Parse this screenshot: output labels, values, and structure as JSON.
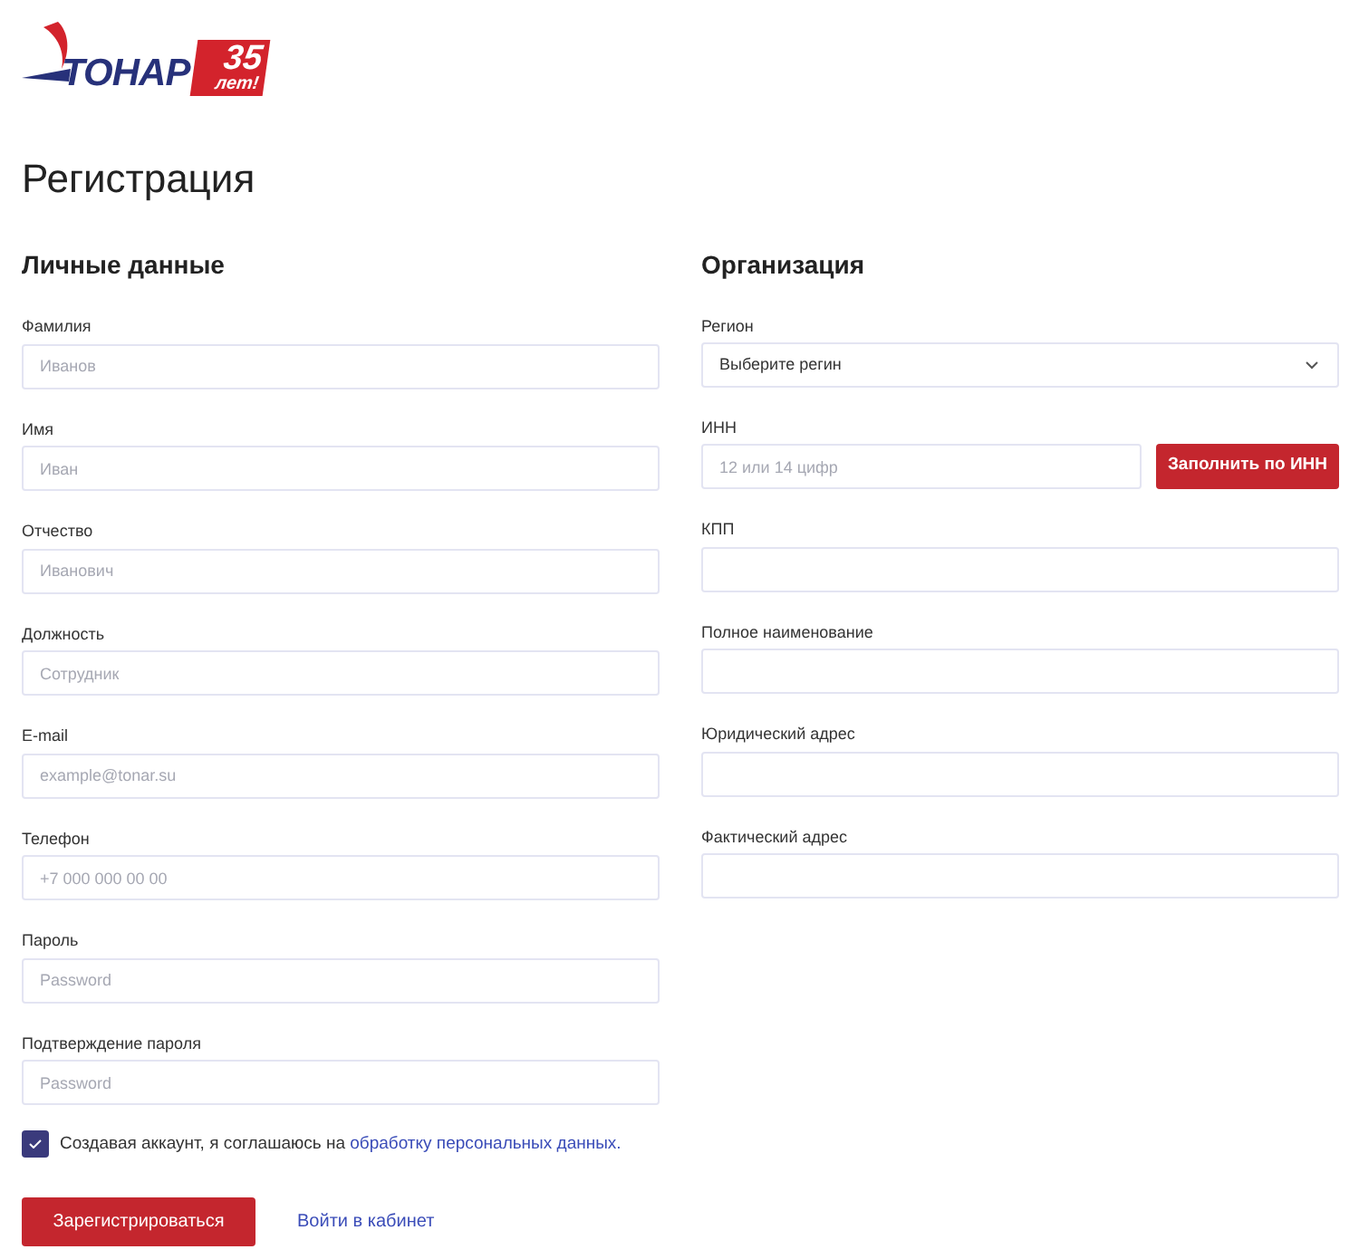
{
  "logo": {
    "brand": "ТОНАР",
    "badge_number": "35",
    "badge_text": "лет!"
  },
  "title": "Регистрация",
  "personal": {
    "heading": "Личные данные",
    "fields": [
      {
        "label": "Фамилия",
        "placeholder": "Иванов"
      },
      {
        "label": "Имя",
        "placeholder": "Иван"
      },
      {
        "label": "Отчество",
        "placeholder": "Иванович"
      },
      {
        "label": "Должность",
        "placeholder": "Сотрудник"
      },
      {
        "label": "E-mail",
        "placeholder": "example@tonar.su"
      },
      {
        "label": "Телефон",
        "placeholder": "+7 000 000 00 00"
      },
      {
        "label": "Пароль",
        "placeholder": "Password"
      },
      {
        "label": "Подтверждение пароля",
        "placeholder": "Password"
      }
    ]
  },
  "organization": {
    "heading": "Организация",
    "fields": [
      {
        "kind": "select",
        "label": "Регион",
        "value": "Выберите регин"
      },
      {
        "kind": "input_with_button",
        "label": "ИНН",
        "placeholder": "12 или 14 цифр",
        "button": "Заполнить по ИНН"
      },
      {
        "kind": "input",
        "label": "КПП"
      },
      {
        "kind": "input",
        "label": "Полное наименование"
      },
      {
        "kind": "input",
        "label": "Юридический адрес"
      },
      {
        "kind": "input",
        "label": "Фактический адрес"
      }
    ]
  },
  "consent": {
    "checked": true,
    "text": "Создавая аккаунт, я соглашаюсь на",
    "link": "обработку персональных данных."
  },
  "actions": {
    "submit": "Зарегистрироваться",
    "login_link": "Войти в кабинет"
  }
}
